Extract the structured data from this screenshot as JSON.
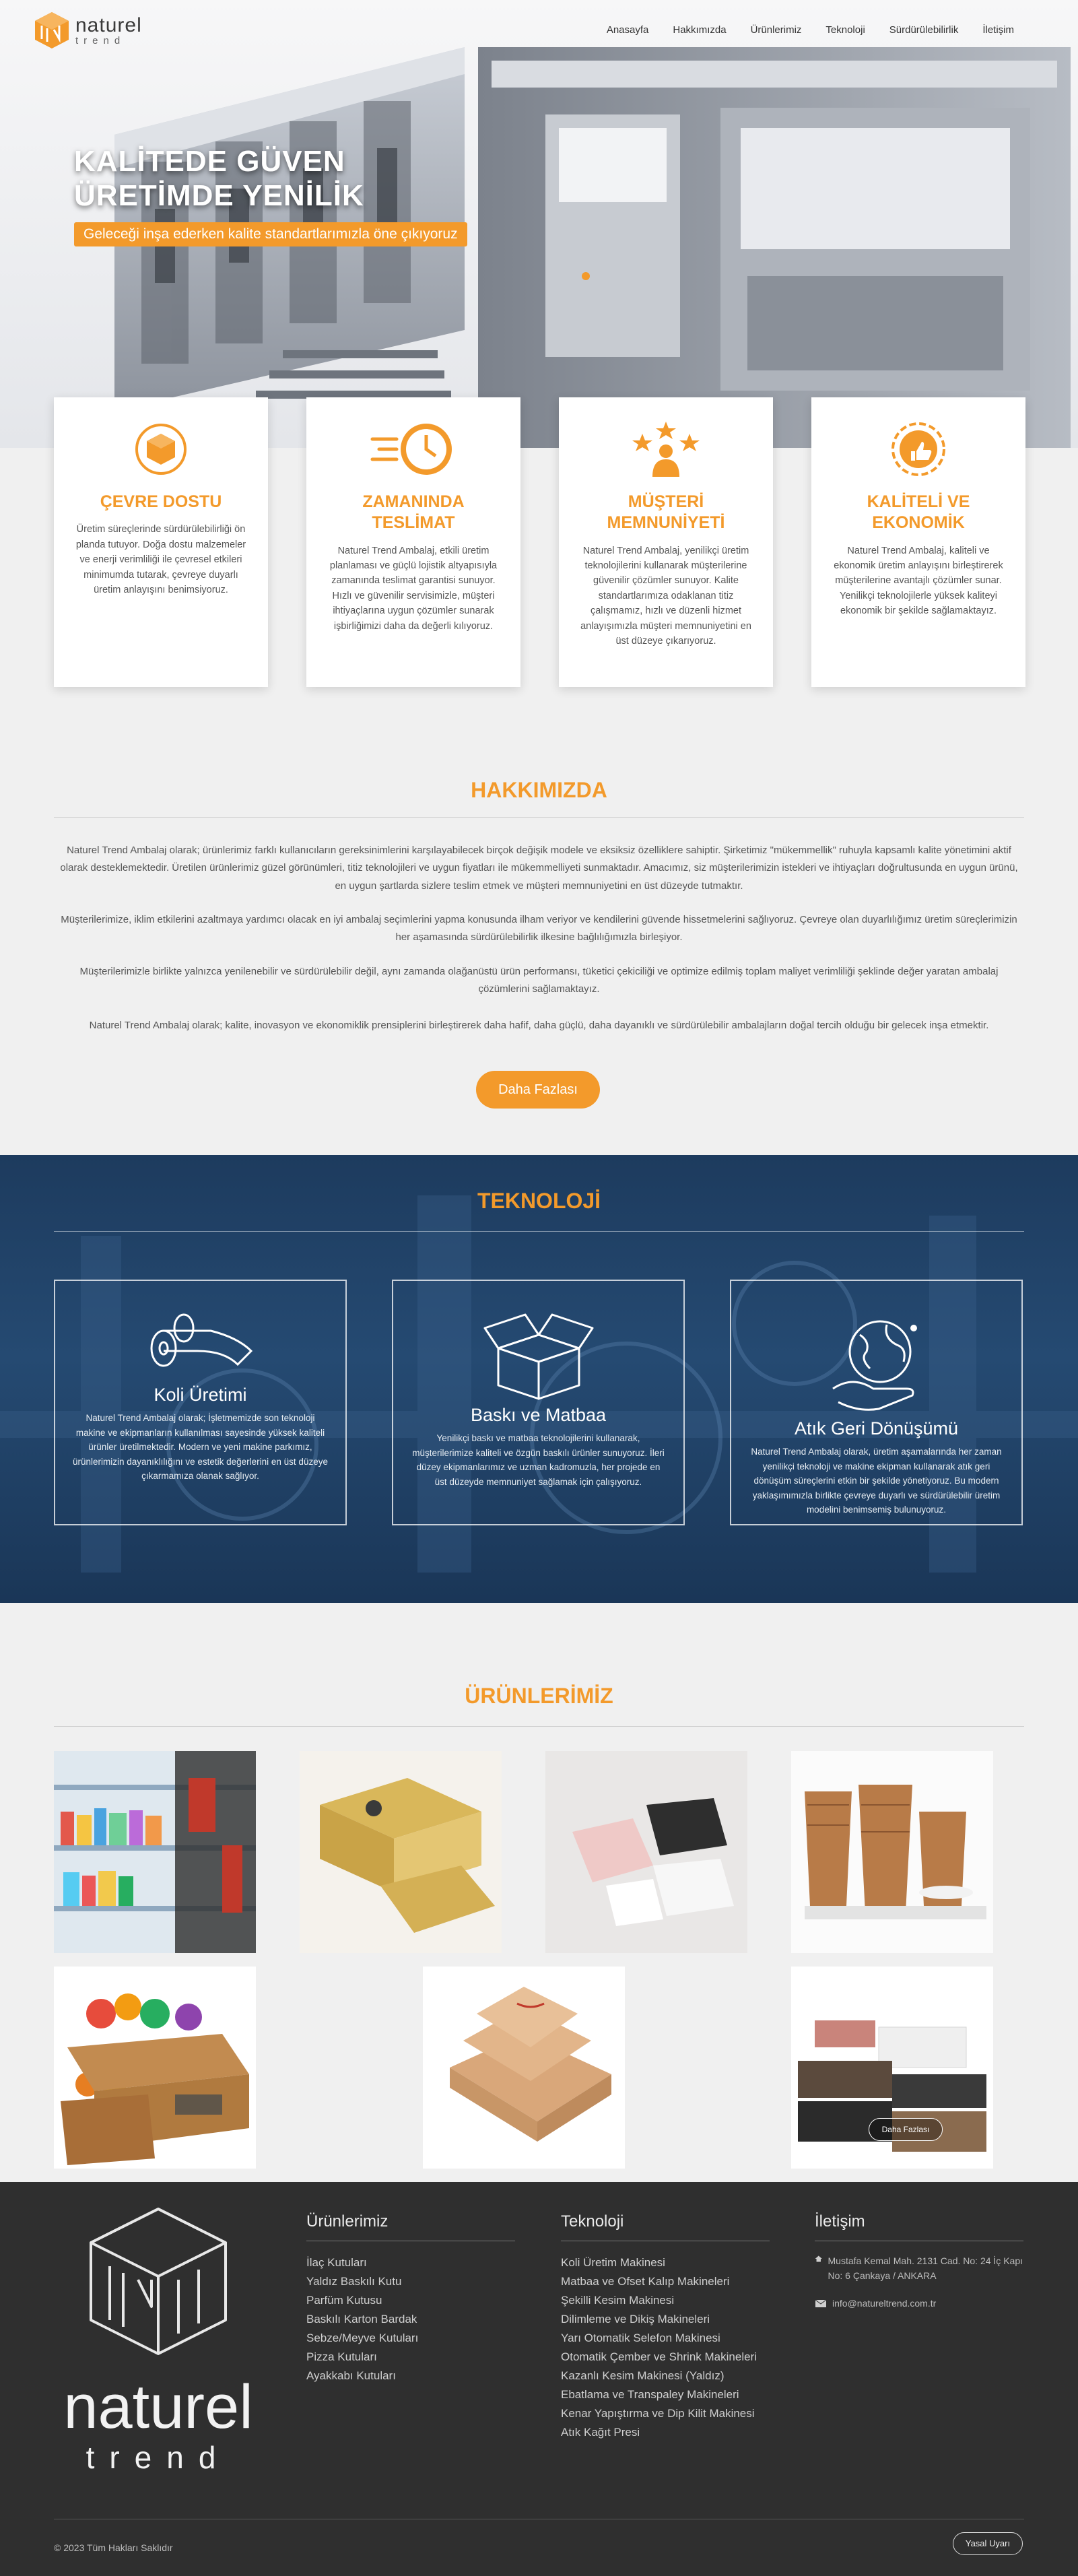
{
  "brand": {
    "name_line1": "naturel",
    "name_line2": "trend",
    "accent_color": "#f39a2b",
    "logo_icon": "cube-logo-icon"
  },
  "nav": [
    {
      "label": "Anasayfa"
    },
    {
      "label": "Hakkımızda"
    },
    {
      "label": "Ürünlerimiz"
    },
    {
      "label": "Teknoloji"
    },
    {
      "label": "Sürdürülebilirlik"
    },
    {
      "label": "İletişim"
    }
  ],
  "hero": {
    "title_line1": "KALİTEDE GÜVEN",
    "title_line2": "ÜRETİMDE YENİLİK",
    "subtitle": "Geleceği inşa ederken kalite standartlarımızla öne çıkıyoruz"
  },
  "features": [
    {
      "icon": "eco-box-icon",
      "title": "ÇEVRE DOSTU",
      "text": "Üretim süreçlerinde sürdürülebilirliği ön planda tutuyor. Doğa dostu malzemeler ve enerji verimliliği ile çevresel etkileri minimumda tutarak, çevreye duyarlı üretim anlayışını benimsiyoruz."
    },
    {
      "icon": "fast-clock-icon",
      "title": "ZAMANINDA TESLİMAT",
      "text": "Naturel Trend Ambalaj, etkili üretim planlaması ve güçlü lojistik altyapısıyla zamanında teslimat garantisi sunuyor. Hızlı ve güvenilir servisimizle, müşteri ihtiyaçlarına uygun çözümler sunarak işbirliğimizi daha da değerli kılıyoruz."
    },
    {
      "icon": "customer-stars-icon",
      "title": "MÜŞTERİ MEMNUNİYETİ",
      "text": "Naturel Trend Ambalaj, yenilikçi üretim teknolojilerini kullanarak müşterilerine güvenilir çözümler sunuyor. Kalite standartlarımıza odaklanan titiz çalışmamız, hızlı ve düzenli hizmet anlayışımızla müşteri memnuniyetini en üst düzeye çıkarıyoruz."
    },
    {
      "icon": "quality-badge-icon",
      "title": "KALİTELİ VE EKONOMİK",
      "text": "Naturel Trend Ambalaj, kaliteli ve ekonomik üretim anlayışını birleştirerek müşterilerine avantajlı çözümler sunar. Yenilikçi teknolojilerle yüksek kaliteyi ekonomik bir şekilde sağlamaktayız."
    }
  ],
  "about": {
    "title": "HAKKIMIZDA",
    "paragraphs": [
      "Naturel Trend Ambalaj olarak; ürünlerimiz farklı kullanıcıların gereksinimlerini karşılayabilecek birçok değişik modele ve eksiksiz özelliklere sahiptir. Şirketimiz \"mükemmellik\" ruhuyla kapsamlı kalite yönetimini aktif olarak desteklemektedir. Üretilen ürünlerimiz güzel görünümleri, titiz teknolojileri ve uygun fiyatları ile mükemmelliyeti sunmaktadır. Amacımız, siz müşterilerimizin istekleri ve ihtiyaçları doğrultusunda en uygun ürünü, en uygun şartlarda sizlere teslim etmek ve müşteri memnuniyetini en üst düzeyde tutmaktır.",
      "Müşterilerimize, iklim etkilerini azaltmaya yardımcı olacak en iyi ambalaj seçimlerini yapma konusunda ilham veriyor ve kendilerini güvende hissetmelerini sağlıyoruz. Çevreye olan duyarlılığımız üretim süreçlerimizin her aşamasında sürdürülebilirlik ilkesine bağlılığımızla birleşiyor.",
      "Müşterilerimizle birlikte yalnızca yenilenebilir ve sürdürülebilir değil, aynı zamanda olağanüstü ürün performansı, tüketici çekiciliği ve optimize edilmiş toplam maliyet verimliliği şeklinde değer yaratan ambalaj çözümlerini sağlamaktayız.",
      "Naturel Trend Ambalaj olarak; kalite, inovasyon ve ekonomiklik prensiplerini birleştirerek daha hafif, daha güçlü, daha dayanıklı ve sürdürülebilir ambalajların doğal tercih olduğu bir gelecek inşa etmektir."
    ],
    "button": "Daha Fazlası"
  },
  "tech": {
    "title": "TEKNOLOJİ",
    "boxes": [
      {
        "icon": "paper-roll-icon",
        "title": "Koli Üretimi",
        "text": "Naturel Trend Ambalaj olarak; İşletmemizde son teknoloji makine ve ekipmanların kullanılması sayesinde yüksek kaliteli ürünler üretilmektedir. Modern ve yeni makine parkımız, ürünlerimizin dayanıklılığını ve estetik değerlerini en üst düzeye çıkarmamıza olanak sağlıyor."
      },
      {
        "icon": "open-box-icon",
        "title": "Baskı ve Matbaa",
        "text": "Yenilikçi baskı ve matbaa teknolojilerini kullanarak, müşterilerimize kaliteli ve özgün baskılı ürünler sunuyoruz. İleri düzey ekipmanlarımız ve uzman kadromuzla, her projede en üst düzeyde memnuniyet sağlamak için çalışıyoruz."
      },
      {
        "icon": "recycle-globe-icon",
        "title": "Atık Geri Dönüşümü",
        "text": "Naturel Trend Ambalaj olarak, üretim aşamalarında her zaman yenilikçi teknoloji ve makine ekipman kullanarak atık geri dönüşüm süreçlerini etkin bir şekilde yönetiyoruz. Bu modern yaklaşımımızla birlikte çevreye duyarlı ve sürdürülebilir üretim modelini benimsemiş bulunuyoruz."
      }
    ]
  },
  "products": {
    "title": "ÜRÜNLERİMİZ",
    "items": [
      {
        "name": "ilac-kutulari-photo"
      },
      {
        "name": "yaldiz-baskili-kutu-photo"
      },
      {
        "name": "parfum-kutusu-photo"
      },
      {
        "name": "karton-bardak-photo"
      },
      {
        "name": "sebze-meyve-kutulari-photo"
      },
      {
        "name": "pizza-kutulari-photo"
      },
      {
        "name": "ayakkabi-kutulari-photo"
      }
    ],
    "overlay_button": "Daha Fazlası"
  },
  "footer": {
    "products": {
      "title": "Ürünlerimiz",
      "links": [
        "İlaç Kutuları",
        "Yaldız Baskılı Kutu",
        "Parfüm Kutusu",
        "Baskılı Karton Bardak",
        "Sebze/Meyve Kutuları",
        "Pizza Kutuları",
        "Ayakkabı Kutuları"
      ]
    },
    "tech": {
      "title": "Teknoloji",
      "links": [
        "Koli Üretim Makinesi",
        "Matbaa ve Ofset Kalıp Makineleri",
        "Şekilli Kesim Makinesi",
        "Dilimleme ve Dikiş Makineleri",
        "Yarı Otomatik Selefon Makinesi",
        "Otomatik Çember ve Shrink Makineleri",
        "Kazanlı Kesim Makinesi (Yaldız)",
        "Ebatlama ve Transpaley Makineleri",
        "Kenar Yapıştırma ve Dip Kilit Makinesi",
        "Atık Kağıt Presi"
      ]
    },
    "contact": {
      "title": "İletişim",
      "address": "Mustafa Kemal Mah. 2131 Cad. No: 24 İç Kapı No: 6 Çankaya / ANKARA",
      "email": "info@natureltrend.com.tr"
    },
    "copyright": "© 2023 Tüm Hakları Saklıdır",
    "legal_button": "Yasal Uyarı"
  }
}
